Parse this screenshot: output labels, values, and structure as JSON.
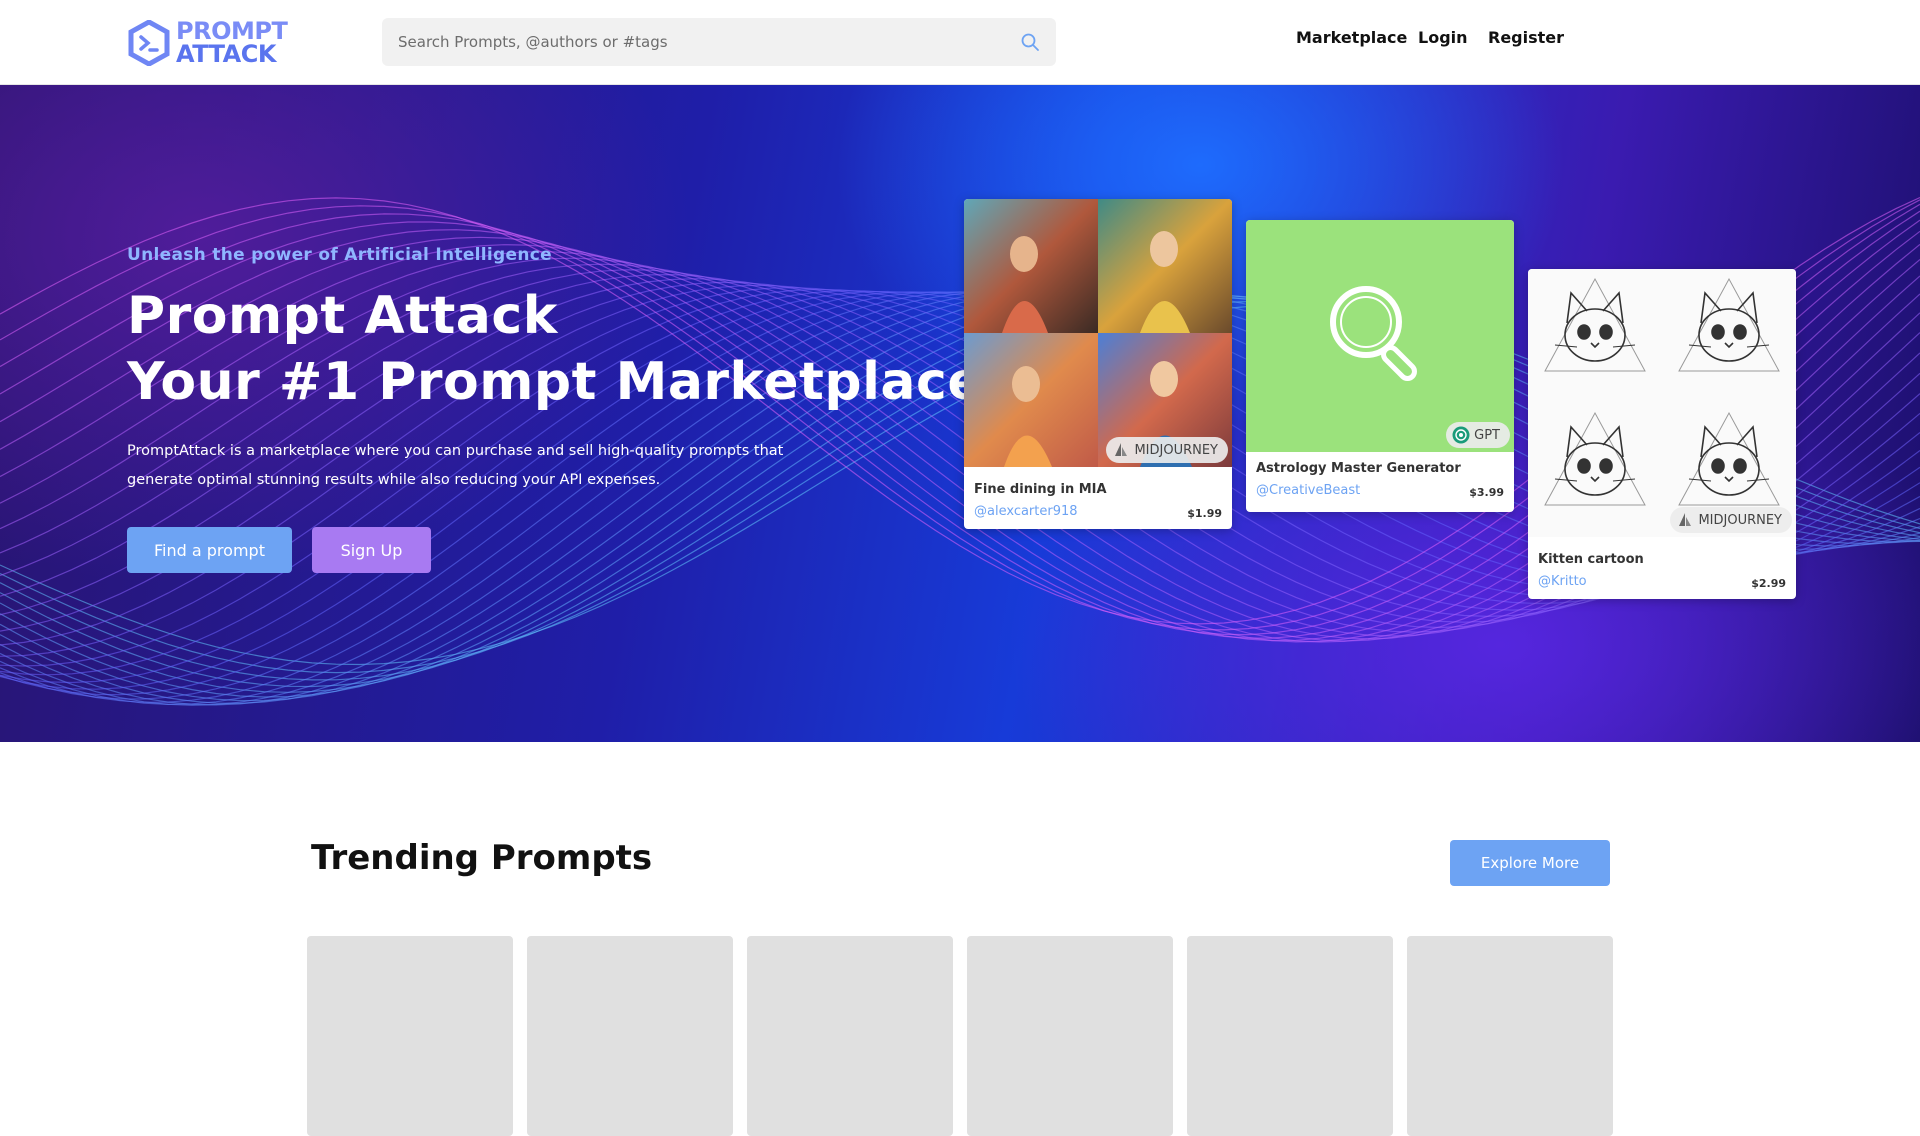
{
  "header": {
    "logo_line1": "PROMPT",
    "logo_line2": "ATTACK",
    "search_placeholder": "Search Prompts, @authors or #tags",
    "nav": [
      {
        "label": "Marketplace"
      },
      {
        "label": "Login"
      },
      {
        "label": "Register"
      }
    ]
  },
  "hero": {
    "tagline": "Unleash the power of Artificial Intelligence",
    "title_line1": "Prompt Attack",
    "title_line2": "Your #1 Prompt Marketplace",
    "description": "PromptAttack is a marketplace where you can purchase and sell high-quality prompts that generate optimal stunning results while also reducing your API expenses.",
    "find_button": "Find a prompt",
    "signup_button": "Sign Up"
  },
  "cards": [
    {
      "title": "Fine dining in MIA",
      "author": "@alexcarter918",
      "price": "$1.99",
      "badge": "MIDJOURNEY",
      "badge_icon": "midjourney-sail-icon"
    },
    {
      "title": "Astrology Master Generator",
      "author": "@CreativeBeast",
      "price": "$3.99",
      "badge": "GPT",
      "badge_icon": "openai-icon",
      "image_color": "#9be27c"
    },
    {
      "title": "Kitten cartoon",
      "author": "@Kritto",
      "price": "$2.99",
      "badge": "MIDJOURNEY",
      "badge_icon": "midjourney-sail-icon"
    }
  ],
  "trending": {
    "title": "Trending Prompts",
    "explore_button": "Explore More"
  },
  "colors": {
    "accent_blue": "#6da3f3",
    "accent_purple": "#a87af2",
    "link": "#6da3f3",
    "skeleton": "#e0e0e0"
  }
}
